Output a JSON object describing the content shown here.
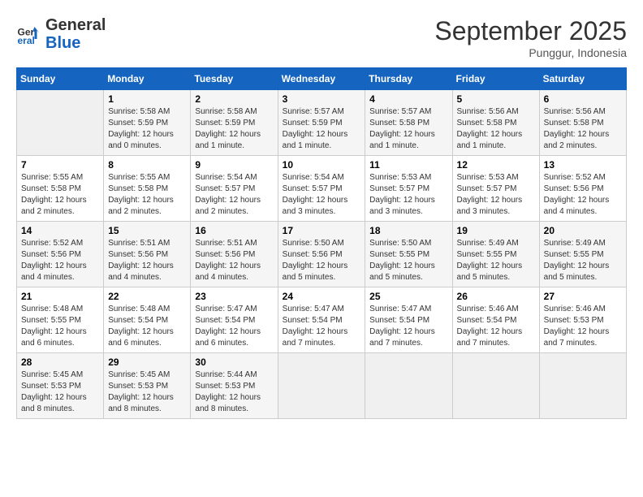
{
  "logo": {
    "line1": "General",
    "line2": "Blue"
  },
  "title": "September 2025",
  "subtitle": "Punggur, Indonesia",
  "days_header": [
    "Sunday",
    "Monday",
    "Tuesday",
    "Wednesday",
    "Thursday",
    "Friday",
    "Saturday"
  ],
  "weeks": [
    [
      {
        "day": "",
        "info": ""
      },
      {
        "day": "1",
        "info": "Sunrise: 5:58 AM\nSunset: 5:59 PM\nDaylight: 12 hours\nand 0 minutes."
      },
      {
        "day": "2",
        "info": "Sunrise: 5:58 AM\nSunset: 5:59 PM\nDaylight: 12 hours\nand 1 minute."
      },
      {
        "day": "3",
        "info": "Sunrise: 5:57 AM\nSunset: 5:59 PM\nDaylight: 12 hours\nand 1 minute."
      },
      {
        "day": "4",
        "info": "Sunrise: 5:57 AM\nSunset: 5:58 PM\nDaylight: 12 hours\nand 1 minute."
      },
      {
        "day": "5",
        "info": "Sunrise: 5:56 AM\nSunset: 5:58 PM\nDaylight: 12 hours\nand 1 minute."
      },
      {
        "day": "6",
        "info": "Sunrise: 5:56 AM\nSunset: 5:58 PM\nDaylight: 12 hours\nand 2 minutes."
      }
    ],
    [
      {
        "day": "7",
        "info": "Sunrise: 5:55 AM\nSunset: 5:58 PM\nDaylight: 12 hours\nand 2 minutes."
      },
      {
        "day": "8",
        "info": "Sunrise: 5:55 AM\nSunset: 5:58 PM\nDaylight: 12 hours\nand 2 minutes."
      },
      {
        "day": "9",
        "info": "Sunrise: 5:54 AM\nSunset: 5:57 PM\nDaylight: 12 hours\nand 2 minutes."
      },
      {
        "day": "10",
        "info": "Sunrise: 5:54 AM\nSunset: 5:57 PM\nDaylight: 12 hours\nand 3 minutes."
      },
      {
        "day": "11",
        "info": "Sunrise: 5:53 AM\nSunset: 5:57 PM\nDaylight: 12 hours\nand 3 minutes."
      },
      {
        "day": "12",
        "info": "Sunrise: 5:53 AM\nSunset: 5:57 PM\nDaylight: 12 hours\nand 3 minutes."
      },
      {
        "day": "13",
        "info": "Sunrise: 5:52 AM\nSunset: 5:56 PM\nDaylight: 12 hours\nand 4 minutes."
      }
    ],
    [
      {
        "day": "14",
        "info": "Sunrise: 5:52 AM\nSunset: 5:56 PM\nDaylight: 12 hours\nand 4 minutes."
      },
      {
        "day": "15",
        "info": "Sunrise: 5:51 AM\nSunset: 5:56 PM\nDaylight: 12 hours\nand 4 minutes."
      },
      {
        "day": "16",
        "info": "Sunrise: 5:51 AM\nSunset: 5:56 PM\nDaylight: 12 hours\nand 4 minutes."
      },
      {
        "day": "17",
        "info": "Sunrise: 5:50 AM\nSunset: 5:56 PM\nDaylight: 12 hours\nand 5 minutes."
      },
      {
        "day": "18",
        "info": "Sunrise: 5:50 AM\nSunset: 5:55 PM\nDaylight: 12 hours\nand 5 minutes."
      },
      {
        "day": "19",
        "info": "Sunrise: 5:49 AM\nSunset: 5:55 PM\nDaylight: 12 hours\nand 5 minutes."
      },
      {
        "day": "20",
        "info": "Sunrise: 5:49 AM\nSunset: 5:55 PM\nDaylight: 12 hours\nand 5 minutes."
      }
    ],
    [
      {
        "day": "21",
        "info": "Sunrise: 5:48 AM\nSunset: 5:55 PM\nDaylight: 12 hours\nand 6 minutes."
      },
      {
        "day": "22",
        "info": "Sunrise: 5:48 AM\nSunset: 5:54 PM\nDaylight: 12 hours\nand 6 minutes."
      },
      {
        "day": "23",
        "info": "Sunrise: 5:47 AM\nSunset: 5:54 PM\nDaylight: 12 hours\nand 6 minutes."
      },
      {
        "day": "24",
        "info": "Sunrise: 5:47 AM\nSunset: 5:54 PM\nDaylight: 12 hours\nand 7 minutes."
      },
      {
        "day": "25",
        "info": "Sunrise: 5:47 AM\nSunset: 5:54 PM\nDaylight: 12 hours\nand 7 minutes."
      },
      {
        "day": "26",
        "info": "Sunrise: 5:46 AM\nSunset: 5:54 PM\nDaylight: 12 hours\nand 7 minutes."
      },
      {
        "day": "27",
        "info": "Sunrise: 5:46 AM\nSunset: 5:53 PM\nDaylight: 12 hours\nand 7 minutes."
      }
    ],
    [
      {
        "day": "28",
        "info": "Sunrise: 5:45 AM\nSunset: 5:53 PM\nDaylight: 12 hours\nand 8 minutes."
      },
      {
        "day": "29",
        "info": "Sunrise: 5:45 AM\nSunset: 5:53 PM\nDaylight: 12 hours\nand 8 minutes."
      },
      {
        "day": "30",
        "info": "Sunrise: 5:44 AM\nSunset: 5:53 PM\nDaylight: 12 hours\nand 8 minutes."
      },
      {
        "day": "",
        "info": ""
      },
      {
        "day": "",
        "info": ""
      },
      {
        "day": "",
        "info": ""
      },
      {
        "day": "",
        "info": ""
      }
    ]
  ]
}
